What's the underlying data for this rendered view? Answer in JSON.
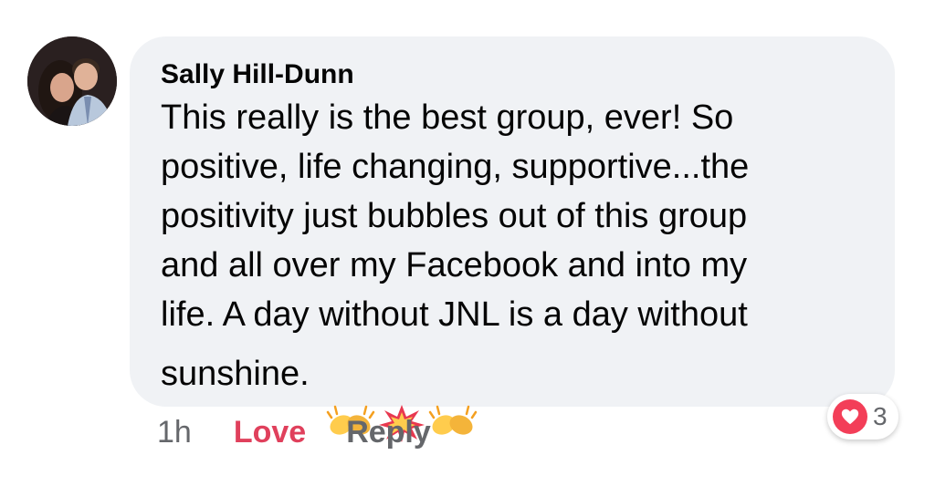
{
  "comment": {
    "author": "Sally Hill-Dunn",
    "text_lines": [
      "This really is the best group, ever! So",
      "positive, life changing, supportive...the",
      "positivity just bubbles out of this group",
      "and all over my Facebook and into my",
      "life. A day without JNL is a day without"
    ],
    "last_line": "sunshine.",
    "emojis": [
      "clapping-hands-emoji",
      "collision-emoji",
      "clapping-hands-emoji"
    ]
  },
  "actions": {
    "time": "1h",
    "love_label": "Love",
    "reply_label": "Reply"
  },
  "reactions": {
    "icon": "heart-icon",
    "count": "3",
    "color": "#f33e58"
  },
  "colors": {
    "bubble": "#f0f2f5",
    "love": "#e0405c",
    "muted": "#65676b"
  }
}
